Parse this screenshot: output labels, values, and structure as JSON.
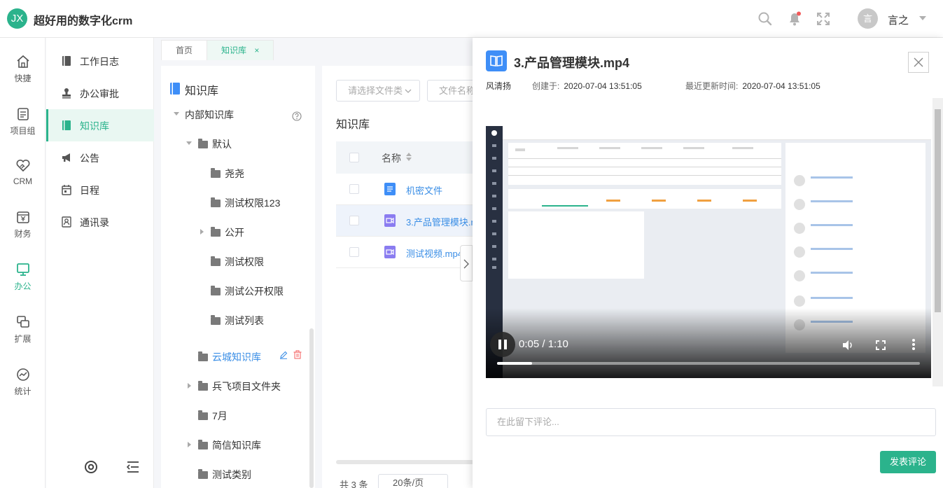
{
  "header": {
    "logo_text": "JX",
    "app_title": "超好用的数字化crm",
    "user_avatar_text": "言",
    "user_name": "言之",
    "icons": [
      "search-icon",
      "bell-icon",
      "fullscreen-icon"
    ],
    "accent_color": "#2bb38c"
  },
  "rail": {
    "items": [
      {
        "label": "快捷",
        "icon": "home-icon"
      },
      {
        "label": "项目组",
        "icon": "project-icon"
      },
      {
        "label": "CRM",
        "icon": "handshake-icon"
      },
      {
        "label": "财务",
        "icon": "finance-icon"
      },
      {
        "label": "办公",
        "icon": "monitor-icon",
        "active": true
      },
      {
        "label": "扩展",
        "icon": "extend-icon"
      },
      {
        "label": "统计",
        "icon": "chart-icon"
      }
    ]
  },
  "submenu": {
    "items": [
      {
        "label": "工作日志",
        "icon": "journal-icon"
      },
      {
        "label": "办公审批",
        "icon": "stamp-icon"
      },
      {
        "label": "知识库",
        "icon": "book-icon",
        "active": true
      },
      {
        "label": "公告",
        "icon": "megaphone-icon"
      },
      {
        "label": "日程",
        "icon": "calendar-icon"
      },
      {
        "label": "通讯录",
        "icon": "contacts-icon"
      }
    ]
  },
  "tabs": [
    {
      "label": "首页"
    },
    {
      "label": "知识库",
      "active": true,
      "close": "×"
    }
  ],
  "tree": {
    "title": "知识库",
    "nodes": [
      "内部知识库",
      "默认",
      "尧尧",
      "测试权限123",
      "公开",
      "测试权限",
      "测试公开权限",
      "测试列表",
      "云城知识库",
      "兵飞项目文件夹",
      "7月",
      "简信知识库",
      "测试类别"
    ]
  },
  "list": {
    "filter_placeholder": "请选择文件类",
    "name_placeholder": "文件名称",
    "title": "知识库",
    "column_name": "名称",
    "rows": [
      {
        "name": "机密文件",
        "type": "doc"
      },
      {
        "name": "3.产品管理模块.mp4",
        "type": "video",
        "selected": true
      },
      {
        "name": "测试视频.mp4",
        "type": "video"
      }
    ],
    "total": "共 3 条",
    "page_size": "20条/页"
  },
  "drawer": {
    "title": "3.产品管理模块.mp4",
    "author": "风清扬",
    "created_label": "创建于:",
    "created_value": "2020-07-04 13:51:05",
    "updated_label": "最近更新时间:",
    "updated_value": "2020-07-04 13:51:05",
    "video": {
      "time": "0:05 / 1:10",
      "progress": 0.083
    },
    "comment_placeholder": "在此留下评论...",
    "submit_label": "发表评论"
  }
}
